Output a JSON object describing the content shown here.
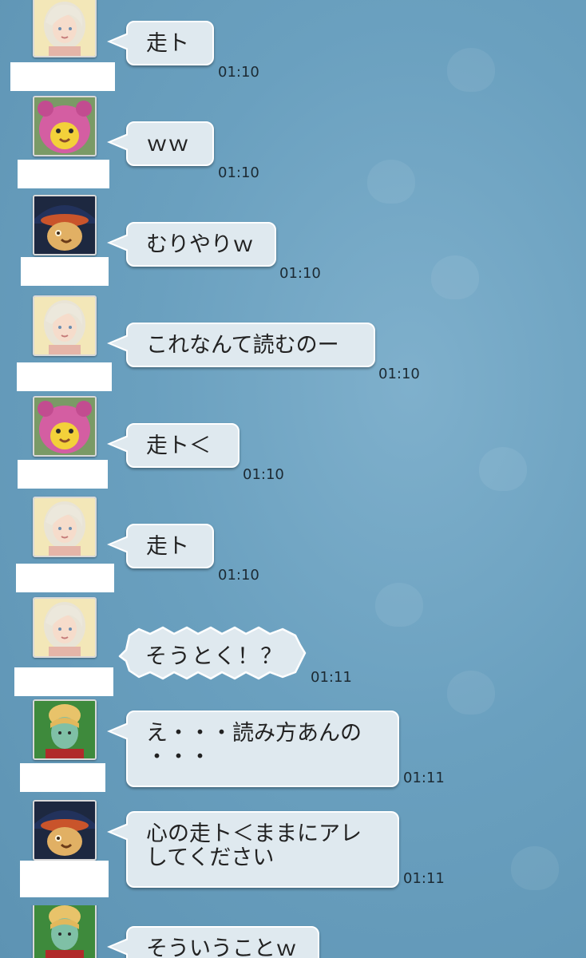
{
  "messages": [
    {
      "avatar": "blonde-woman",
      "text": "走ト",
      "time": "01:10"
    },
    {
      "avatar": "pink-bear",
      "text": "ｗｗ",
      "time": "01:10"
    },
    {
      "avatar": "wizard-hat",
      "text": "むりやりｗ",
      "time": "01:10"
    },
    {
      "avatar": "blonde-woman",
      "text": "これなんて読むのー",
      "time": "01:10"
    },
    {
      "avatar": "pink-bear",
      "text": "走ト＜",
      "time": "01:10"
    },
    {
      "avatar": "blonde-woman",
      "text": "走ト",
      "time": "01:10"
    },
    {
      "avatar": "blonde-woman",
      "text": "そうとく！？",
      "time": "01:11",
      "style": "shout"
    },
    {
      "avatar": "green-elf",
      "line1": "え・・・読み方あんの",
      "line2": "・・・",
      "time": "01:11"
    },
    {
      "avatar": "wizard-hat",
      "line1": "心の走ト＜ままにアレ",
      "line2": "してください",
      "time": "01:11"
    },
    {
      "avatar": "green-elf",
      "text": "そういうことｗ"
    }
  ],
  "colors": {
    "bubble": "#dfe9ef",
    "bubble_border": "#ffffff",
    "background": "#6aa0bf",
    "timestamp": "#1c2a33"
  }
}
